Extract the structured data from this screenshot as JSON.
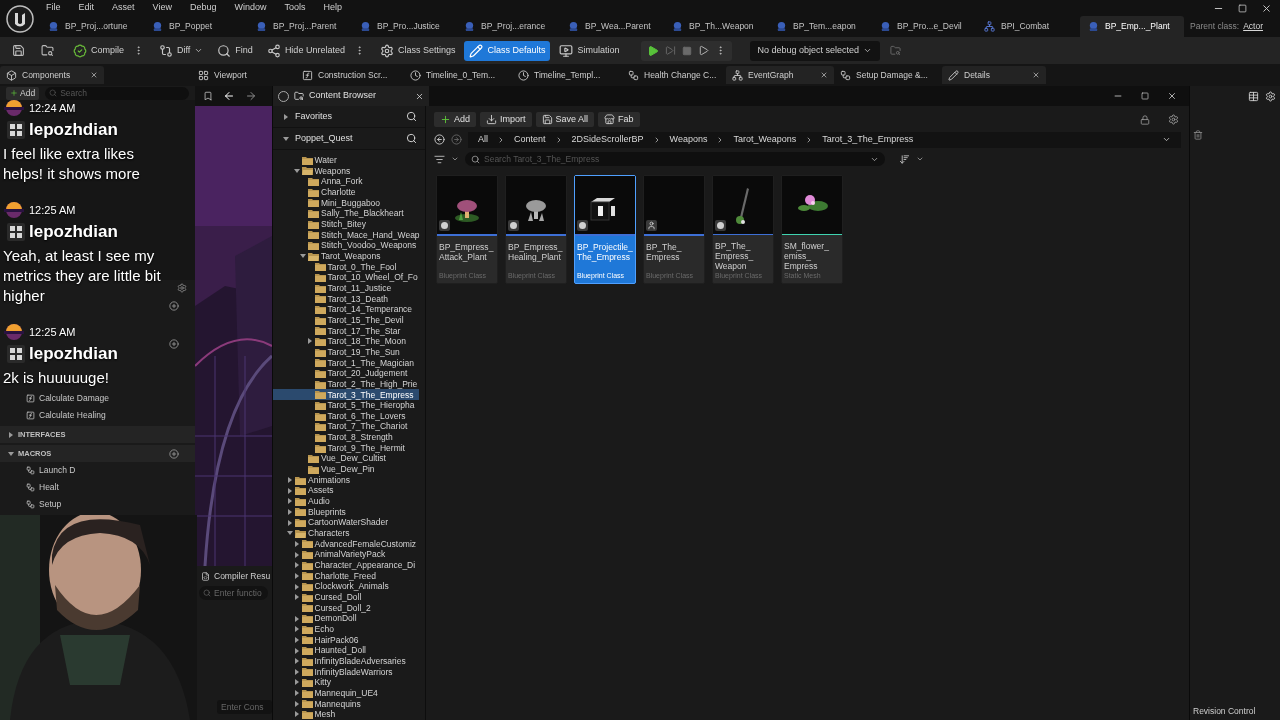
{
  "menu": [
    "File",
    "Edit",
    "Asset",
    "View",
    "Debug",
    "Window",
    "Tools",
    "Help"
  ],
  "asset_tabs": [
    {
      "label": "BP_Proj...ortune",
      "kind": "blueprint",
      "selected": false
    },
    {
      "label": "BP_Poppet",
      "kind": "blueprint",
      "selected": false
    },
    {
      "label": "BP_Proj...Parent",
      "kind": "blueprint",
      "selected": false
    },
    {
      "label": "BP_Pro...Justice",
      "kind": "blueprint",
      "selected": false
    },
    {
      "label": "BP_Proj...erance",
      "kind": "blueprint",
      "selected": false
    },
    {
      "label": "BP_Wea...Parent",
      "kind": "blueprint",
      "selected": false
    },
    {
      "label": "BP_Th...Weapon",
      "kind": "blueprint",
      "selected": false
    },
    {
      "label": "BP_Tem...eapon",
      "kind": "blueprint",
      "selected": false
    },
    {
      "label": "BP_Pro...e_Devil",
      "kind": "blueprint",
      "selected": false
    },
    {
      "label": "BPI_Combat",
      "kind": "interface",
      "selected": false
    },
    {
      "label": "BP_Emp..._Plant",
      "kind": "blueprint",
      "selected": true
    }
  ],
  "parent_class": {
    "label": "Parent class:",
    "value": "Actor"
  },
  "toolbar": [
    {
      "label": "Compile",
      "kind": "compile",
      "selected": false
    },
    {
      "label": "Diff",
      "kind": "diff",
      "selected": false
    },
    {
      "label": "Find",
      "kind": "find",
      "selected": false
    },
    {
      "label": "Hide Unrelated",
      "kind": "hide",
      "selected": false
    },
    {
      "label": "Class Settings",
      "kind": "settings",
      "selected": false
    },
    {
      "label": "Class Defaults",
      "kind": "defaults",
      "selected": true
    },
    {
      "label": "Simulation",
      "kind": "simulation",
      "selected": false
    }
  ],
  "debug_object": "No debug object selected",
  "panel_tabs": [
    {
      "label": "Components",
      "kind": "components",
      "closable": true
    },
    {
      "label": "Viewport",
      "kind": "viewport",
      "closable": false
    },
    {
      "label": "Construction Scr...",
      "kind": "function",
      "closable": false
    },
    {
      "label": "Timeline_0_Tem...",
      "kind": "timeline",
      "closable": false
    },
    {
      "label": "Timeline_Templ...",
      "kind": "timeline",
      "closable": false
    },
    {
      "label": "Health Change C...",
      "kind": "macro",
      "closable": false
    },
    {
      "label": "EventGraph",
      "kind": "graph",
      "closable": true
    },
    {
      "label": "Setup Damage &...",
      "kind": "macro",
      "closable": false
    },
    {
      "label": "Details",
      "kind": "details",
      "closable": true
    }
  ],
  "components": {
    "add": "Add",
    "search_placeholder": "Search"
  },
  "my_blueprint": {
    "functions": [
      "Calculate Damage",
      "Calculate Healing"
    ],
    "sections": [
      {
        "label": "INTERFACES",
        "expanded": false
      },
      {
        "label": "MACROS",
        "expanded": true,
        "items": [
          "Launch D",
          "Healt",
          "Setup"
        ]
      }
    ]
  },
  "chat": [
    {
      "time": "12:24 AM",
      "user": "lepozhdian",
      "message": "I feel like extra likes helps! it shows more"
    },
    {
      "time": "12:25 AM",
      "user": "lepozhdian",
      "message": "Yeah, at least I see my metrics they are little bit higher"
    },
    {
      "time": "12:25 AM",
      "user": "lepozhdian",
      "message": "2k is huuuuuge!"
    }
  ],
  "viewport": {
    "kind": "picture"
  },
  "webcam": {
    "kind": "picture"
  },
  "compiler_results": {
    "title": "Compiler Resu",
    "search_placeholder": "Enter functio"
  },
  "console": {
    "placeholder": "Enter Cons"
  },
  "content_browser": {
    "title": "Content Browser",
    "favorites": {
      "label": "Favorites",
      "expanded": false
    },
    "root": {
      "label": "Poppet_Quest",
      "expanded": true
    },
    "tree": [
      {
        "children": [
          {
            "name": "Water",
            "selected": false
          },
          {
            "name": "Weapons",
            "expanded": true,
            "selected": false,
            "children": [
              {
                "name": "Anna_Fork",
                "selected": false
              },
              {
                "name": "Charlotte",
                "selected": false
              },
              {
                "name": "Mini_Buggaboo",
                "selected": false
              },
              {
                "name": "Sally_The_Blackheart",
                "selected": false
              },
              {
                "name": "Stitch_Bitey",
                "selected": false
              },
              {
                "name": "Stitch_Mace_Hand_Weap",
                "selected": false
              },
              {
                "name": "Stitch_Voodoo_Weapons",
                "selected": false
              },
              {
                "name": "Tarot_Weapons",
                "expanded": true,
                "selected": false,
                "children": [
                  {
                    "name": "Tarot_0_The_Fool",
                    "selected": false
                  },
                  {
                    "name": "Tarot_10_Wheel_Of_Fo",
                    "selected": false
                  },
                  {
                    "name": "Tarot_11_Justice",
                    "selected": false
                  },
                  {
                    "name": "Tarot_13_Death",
                    "selected": false
                  },
                  {
                    "name": "Tarot_14_Temperance",
                    "selected": false
                  },
                  {
                    "name": "Tarot_15_The_Devil",
                    "selected": false
                  },
                  {
                    "name": "Tarot_17_The_Star",
                    "selected": false
                  },
                  {
                    "name": "Tarot_18_The_Moon",
                    "expanded": false,
                    "selected": false
                  },
                  {
                    "name": "Tarot_19_The_Sun",
                    "selected": false
                  },
                  {
                    "name": "Tarot_1_The_Magician",
                    "selected": false
                  },
                  {
                    "name": "Tarot_20_Judgement",
                    "selected": false
                  },
                  {
                    "name": "Tarot_2_The_High_Prie",
                    "selected": false
                  },
                  {
                    "name": "Tarot_3_The_Empress",
                    "selected": true
                  },
                  {
                    "name": "Tarot_5_The_Hieropha",
                    "selected": false
                  },
                  {
                    "name": "Tarot_6_The_Lovers",
                    "selected": false
                  },
                  {
                    "name": "Tarot_7_The_Chariot",
                    "selected": false
                  },
                  {
                    "name": "Tarot_8_Strength",
                    "selected": false
                  },
                  {
                    "name": "Tarot_9_The_Hermit",
                    "selected": false
                  }
                ]
              },
              {
                "name": "Vue_Dew_Cultist",
                "selected": false
              },
              {
                "name": "Vue_Dew_Pin",
                "selected": false
              }
            ]
          }
        ]
      },
      {
        "name": "Animations",
        "expanded": false,
        "selected": false
      },
      {
        "name": "Assets",
        "expanded": false,
        "selected": false
      },
      {
        "name": "Audio",
        "expanded": false,
        "selected": false
      },
      {
        "name": "Blueprints",
        "expanded": false,
        "selected": false
      },
      {
        "name": "CartoonWaterShader",
        "expanded": false,
        "selected": false
      },
      {
        "name": "Characters",
        "expanded": true,
        "selected": false,
        "children": [
          {
            "name": "AdvancedFemaleCustomiz",
            "expanded": false,
            "selected": false
          },
          {
            "name": "AnimalVarietyPack",
            "expanded": false,
            "selected": false
          },
          {
            "name": "Character_Appearance_Di",
            "expanded": false,
            "selected": false
          },
          {
            "name": "Charlotte_Freed",
            "expanded": false,
            "selected": false
          },
          {
            "name": "Clockwork_Animals",
            "expanded": false,
            "selected": false
          },
          {
            "name": "Cursed_Doll",
            "expanded": false,
            "selected": false
          },
          {
            "name": "Cursed_Doll_2",
            "selected": false
          },
          {
            "name": "DemonDoll",
            "expanded": false,
            "selected": false
          },
          {
            "name": "Echo",
            "expanded": false,
            "selected": false
          },
          {
            "name": "HairPack06",
            "expanded": false,
            "selected": false
          },
          {
            "name": "Haunted_Doll",
            "expanded": false,
            "selected": false
          },
          {
            "name": "InfinityBladeAdversaries",
            "expanded": false,
            "selected": false
          },
          {
            "name": "InfinityBladeWarriors",
            "expanded": false,
            "selected": false
          },
          {
            "name": "Kitty",
            "expanded": false,
            "selected": false
          },
          {
            "name": "Mannequin_UE4",
            "expanded": false,
            "selected": false
          },
          {
            "name": "Mannequins",
            "expanded": false,
            "selected": false
          },
          {
            "name": "Mesh",
            "expanded": false,
            "selected": false
          }
        ]
      }
    ],
    "actions": [
      {
        "label": "Add",
        "kind": "add"
      },
      {
        "label": "Import",
        "kind": "import"
      },
      {
        "label": "Save All",
        "kind": "save"
      },
      {
        "label": "Fab",
        "kind": "fab"
      }
    ],
    "breadcrumbs": [
      "All",
      "Content",
      "2DSideScrollerBP",
      "Weapons",
      "Tarot_Weapons",
      "Tarot_3_The_Empress"
    ],
    "search_placeholder": "Search Tarot_3_The_Empress",
    "assets": [
      {
        "name": "BP_Empress_Attack_Plant",
        "type": "Blueprint Class",
        "thumbnail": {
          "kind": "picture"
        },
        "badge": {
          "kind": "class"
        },
        "color": "#3d6fd6",
        "selected": false
      },
      {
        "name": "BP_Empress_Healing_Plant",
        "type": "Blueprint Class",
        "thumbnail": {
          "kind": "picture"
        },
        "badge": {
          "kind": "class"
        },
        "color": "#3d6fd6",
        "selected": false
      },
      {
        "name": "BP_Projectile_The_Empress",
        "type": "Blueprint Class",
        "thumbnail": {
          "kind": "picture"
        },
        "badge": {
          "kind": "class"
        },
        "color": "#3d6fd6",
        "selected": true
      },
      {
        "name": "BP_The_Empress",
        "type": "Blueprint Class",
        "badge": {
          "kind": "character"
        },
        "color": "#3d6fd6",
        "selected": false
      },
      {
        "name": "BP_The_Empress_Weapon",
        "type": "Blueprint Class",
        "thumbnail": {
          "kind": "picture"
        },
        "badge": {
          "kind": "class"
        },
        "color": "#3d6fd6",
        "selected": false
      },
      {
        "name": "SM_flower_emiss_Empress",
        "type": "Static Mesh",
        "thumbnail": {
          "kind": "picture"
        },
        "color": "#3fd3b0",
        "selected": false
      }
    ]
  },
  "status_bar": {
    "revision_control": "Revision Control"
  }
}
